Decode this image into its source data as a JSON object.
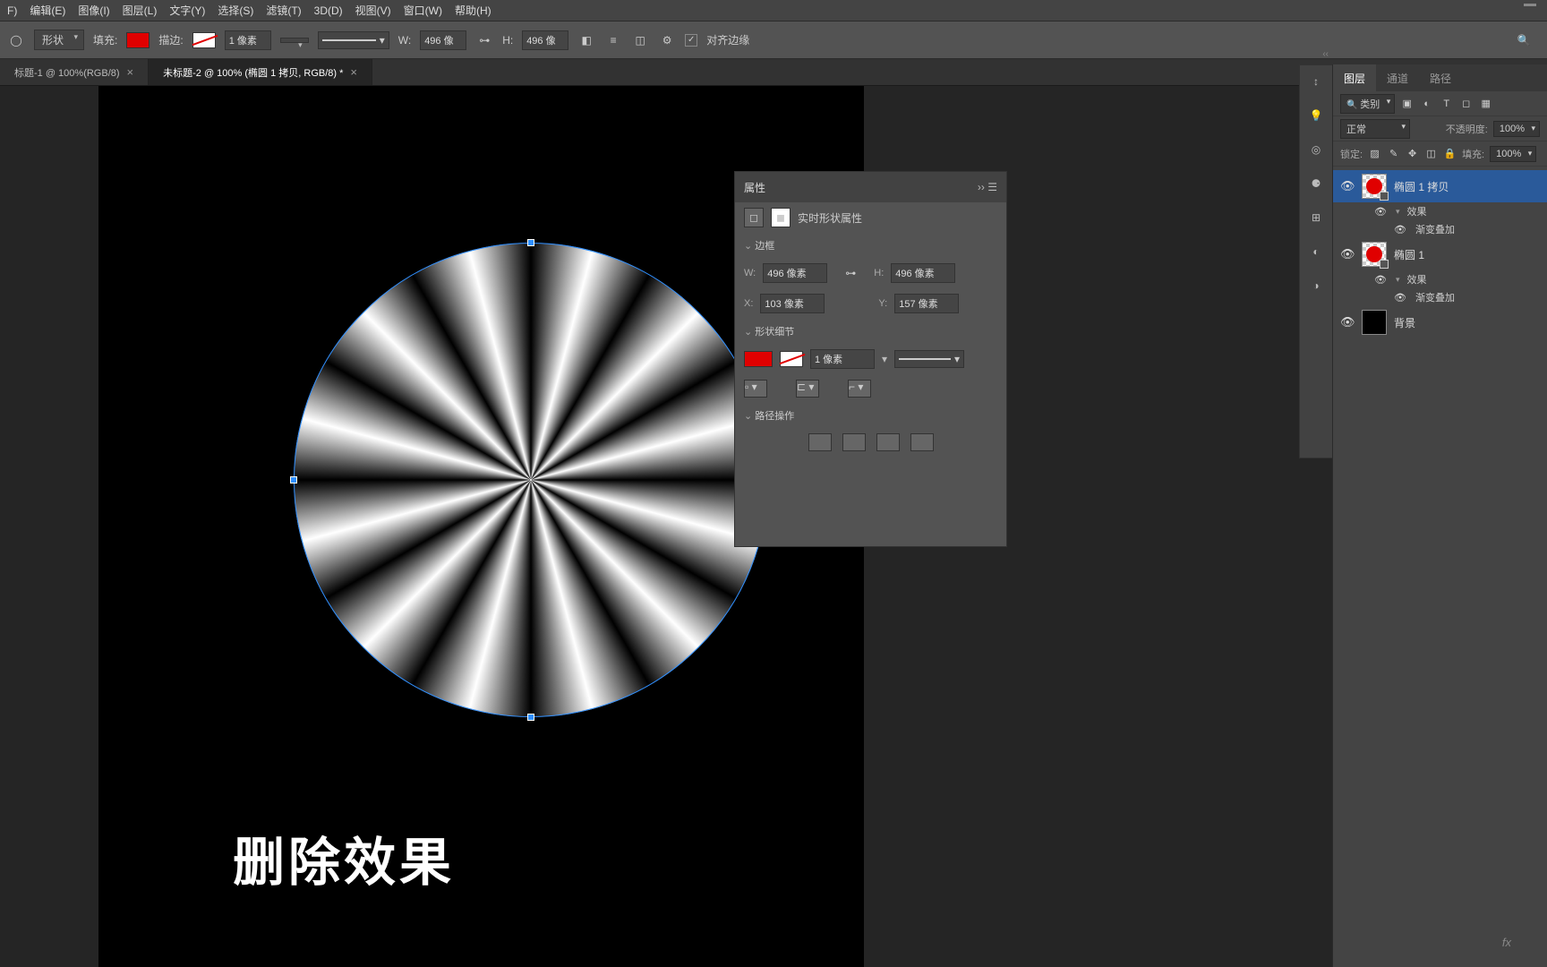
{
  "menu": {
    "items": [
      "F)",
      "编辑(E)",
      "图像(I)",
      "图层(L)",
      "文字(Y)",
      "选择(S)",
      "滤镜(T)",
      "3D(D)",
      "视图(V)",
      "窗口(W)",
      "帮助(H)"
    ]
  },
  "optionbar": {
    "tool_mode": "形状",
    "fill_label": "填充:",
    "stroke_label": "描边:",
    "stroke_width": "1 像素",
    "w_label": "W:",
    "w_value": "496 像",
    "h_label": "H:",
    "h_value": "496 像",
    "align_edges": "对齐边缘"
  },
  "tabs": {
    "items": [
      {
        "label": "标题-1 @ 100%(RGB/8)",
        "active": false
      },
      {
        "label": "未标题-2 @ 100% (椭圆 1 拷贝, RGB/8) *",
        "active": true
      }
    ]
  },
  "overlay_text": "删除效果",
  "properties": {
    "title": "属性",
    "live_shape": "实时形状属性",
    "sections": {
      "border": "边框",
      "shape_detail": "形状细节",
      "path_ops": "路径操作"
    },
    "w": {
      "label": "W:",
      "value": "496 像素"
    },
    "h": {
      "label": "H:",
      "value": "496 像素"
    },
    "x": {
      "label": "X:",
      "value": "103 像素"
    },
    "y": {
      "label": "Y:",
      "value": "157 像素"
    },
    "stroke_width": "1 像素"
  },
  "layers_panel": {
    "tabs": [
      "图层",
      "通道",
      "路径"
    ],
    "filter": "类别",
    "blend_mode": "正常",
    "opacity_label": "不透明度:",
    "opacity_value": "100%",
    "lock_label": "锁定:",
    "fill_label": "填充:",
    "fill_value": "100%",
    "layers": [
      {
        "name": "椭圆 1 拷贝",
        "effects": "效果",
        "fx_items": [
          "渐变叠加"
        ],
        "selected": true
      },
      {
        "name": "椭圆 1",
        "effects": "效果",
        "fx_items": [
          "渐变叠加"
        ],
        "selected": false
      },
      {
        "name": "背景",
        "bg": true
      }
    ],
    "fx_symbol": "fx"
  }
}
